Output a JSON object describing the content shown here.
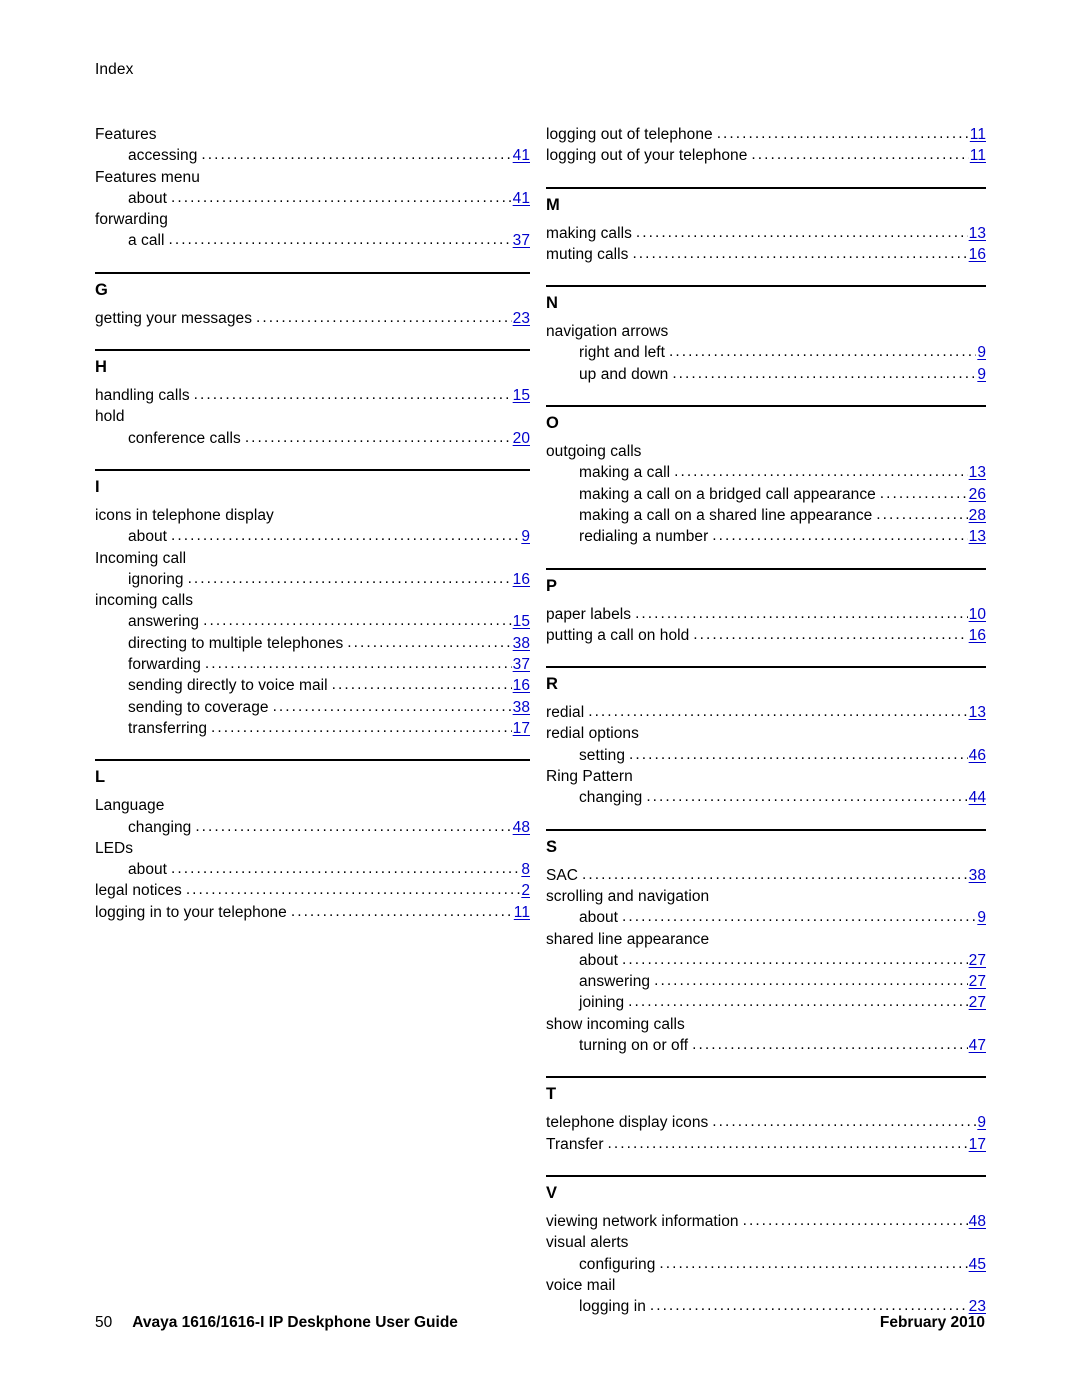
{
  "document": {
    "header": "Index",
    "footer": {
      "page_number": "50",
      "title": "Avaya 1616/1616-I IP Deskphone User Guide",
      "date": "February 2010"
    },
    "link_color": "#0000CC"
  },
  "columns": {
    "left": [
      {
        "type": "entries",
        "entries": [
          {
            "level": 1,
            "text": "Features",
            "page": ""
          },
          {
            "level": 2,
            "text": "accessing",
            "page": "41"
          },
          {
            "level": 1,
            "text": "Features menu",
            "page": ""
          },
          {
            "level": 2,
            "text": "about",
            "page": "41"
          },
          {
            "level": 1,
            "text": "forwarding",
            "page": ""
          },
          {
            "level": 2,
            "text": "a call",
            "page": "37"
          }
        ]
      },
      {
        "type": "section",
        "letter": "G",
        "entries": [
          {
            "level": 1,
            "text": "getting your messages",
            "page": "23"
          }
        ]
      },
      {
        "type": "section",
        "letter": "H",
        "entries": [
          {
            "level": 1,
            "text": "handling calls",
            "page": "15"
          },
          {
            "level": 1,
            "text": "hold",
            "page": ""
          },
          {
            "level": 2,
            "text": "conference calls",
            "page": "20"
          }
        ]
      },
      {
        "type": "section",
        "letter": "I",
        "entries": [
          {
            "level": 1,
            "text": "icons in telephone display",
            "page": ""
          },
          {
            "level": 2,
            "text": "about",
            "page": "9"
          },
          {
            "level": 1,
            "text": "Incoming call",
            "page": ""
          },
          {
            "level": 2,
            "text": "ignoring",
            "page": "16"
          },
          {
            "level": 1,
            "text": "incoming calls",
            "page": ""
          },
          {
            "level": 2,
            "text": "answering",
            "page": "15"
          },
          {
            "level": 2,
            "text": "directing to multiple telephones",
            "page": "38"
          },
          {
            "level": 2,
            "text": "forwarding",
            "page": "37"
          },
          {
            "level": 2,
            "text": "sending directly to voice mail",
            "page": "16"
          },
          {
            "level": 2,
            "text": "sending to coverage",
            "page": "38"
          },
          {
            "level": 2,
            "text": "transferring",
            "page": "17"
          }
        ]
      },
      {
        "type": "section",
        "letter": "L",
        "entries": [
          {
            "level": 1,
            "text": "Language",
            "page": ""
          },
          {
            "level": 2,
            "text": "changing",
            "page": "48"
          },
          {
            "level": 1,
            "text": "LEDs",
            "page": ""
          },
          {
            "level": 2,
            "text": "about",
            "page": "8"
          },
          {
            "level": 1,
            "text": "legal notices",
            "page": "2"
          },
          {
            "level": 1,
            "text": "logging in to your telephone",
            "page": "11"
          }
        ]
      }
    ],
    "right": [
      {
        "type": "entries",
        "entries": [
          {
            "level": 1,
            "text": "logging out of telephone",
            "page": "11"
          },
          {
            "level": 1,
            "text": "logging out of your telephone",
            "page": "11"
          }
        ]
      },
      {
        "type": "section",
        "letter": "M",
        "entries": [
          {
            "level": 1,
            "text": "making calls",
            "page": "13"
          },
          {
            "level": 1,
            "text": "muting calls",
            "page": "16"
          }
        ]
      },
      {
        "type": "section",
        "letter": "N",
        "entries": [
          {
            "level": 1,
            "text": "navigation arrows",
            "page": ""
          },
          {
            "level": 2,
            "text": "right and left",
            "page": "9"
          },
          {
            "level": 2,
            "text": "up and down",
            "page": "9"
          }
        ]
      },
      {
        "type": "section",
        "letter": "O",
        "entries": [
          {
            "level": 1,
            "text": "outgoing calls",
            "page": ""
          },
          {
            "level": 2,
            "text": "making a call",
            "page": "13"
          },
          {
            "level": 2,
            "text": "making a call on a bridged call appearance",
            "page": "26"
          },
          {
            "level": 2,
            "text": "making a call on a shared line appearance",
            "page": "28"
          },
          {
            "level": 2,
            "text": "redialing a number",
            "page": "13"
          }
        ]
      },
      {
        "type": "section",
        "letter": "P",
        "entries": [
          {
            "level": 1,
            "text": "paper labels",
            "page": "10"
          },
          {
            "level": 1,
            "text": "putting a call on hold",
            "page": "16"
          }
        ]
      },
      {
        "type": "section",
        "letter": "R",
        "entries": [
          {
            "level": 1,
            "text": "redial",
            "page": "13"
          },
          {
            "level": 1,
            "text": "redial options",
            "page": ""
          },
          {
            "level": 2,
            "text": "setting",
            "page": "46"
          },
          {
            "level": 1,
            "text": "Ring Pattern",
            "page": ""
          },
          {
            "level": 2,
            "text": "changing",
            "page": "44"
          }
        ]
      },
      {
        "type": "section",
        "letter": "S",
        "entries": [
          {
            "level": 1,
            "text": "SAC",
            "page": "38"
          },
          {
            "level": 1,
            "text": "scrolling and navigation",
            "page": ""
          },
          {
            "level": 2,
            "text": "about",
            "page": "9"
          },
          {
            "level": 1,
            "text": "shared line appearance",
            "page": ""
          },
          {
            "level": 2,
            "text": "about",
            "page": "27"
          },
          {
            "level": 2,
            "text": "answering",
            "page": "27"
          },
          {
            "level": 2,
            "text": "joining",
            "page": "27"
          },
          {
            "level": 1,
            "text": "show incoming calls",
            "page": ""
          },
          {
            "level": 2,
            "text": "turning on or off",
            "page": "47"
          }
        ]
      },
      {
        "type": "section",
        "letter": "T",
        "entries": [
          {
            "level": 1,
            "text": "telephone display icons",
            "page": "9"
          },
          {
            "level": 1,
            "text": "Transfer",
            "page": "17"
          }
        ]
      },
      {
        "type": "section",
        "letter": "V",
        "entries": [
          {
            "level": 1,
            "text": "viewing network information",
            "page": "48"
          },
          {
            "level": 1,
            "text": "visual alerts",
            "page": ""
          },
          {
            "level": 2,
            "text": "configuring",
            "page": "45"
          },
          {
            "level": 1,
            "text": "voice mail",
            "page": ""
          },
          {
            "level": 2,
            "text": "logging in",
            "page": "23"
          }
        ]
      }
    ]
  }
}
